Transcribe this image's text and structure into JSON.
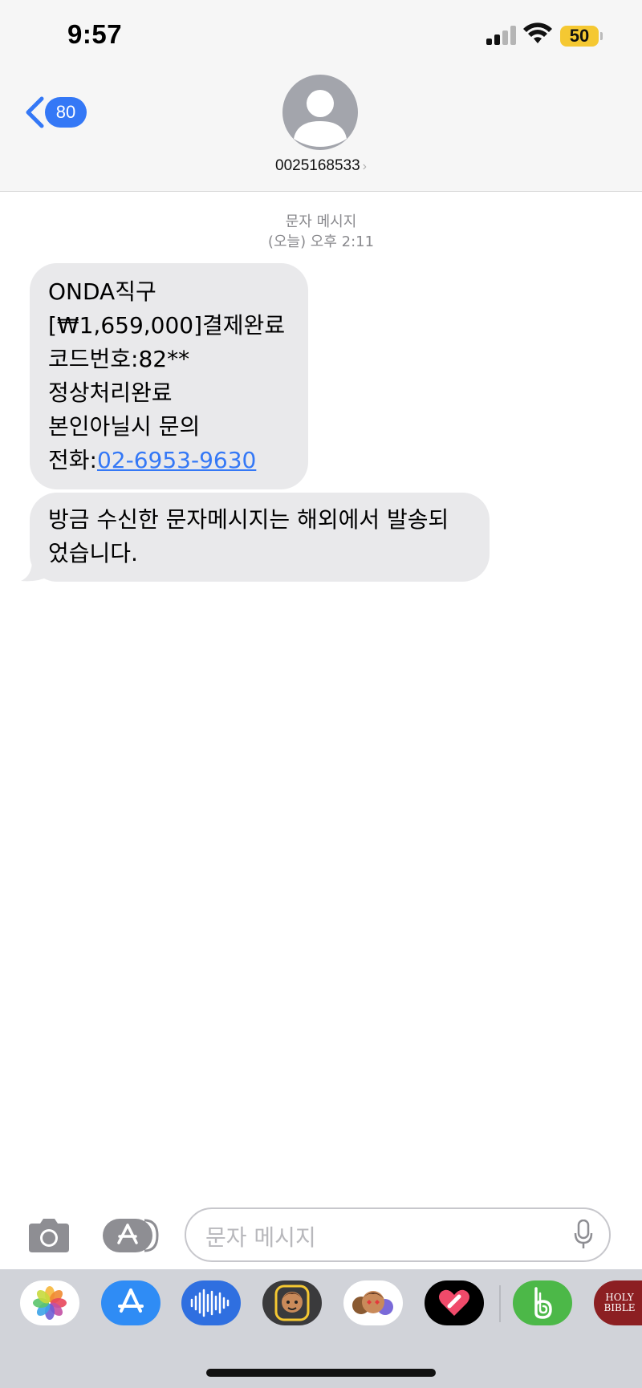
{
  "status_bar": {
    "time": "9:57",
    "battery": "50"
  },
  "header": {
    "back_count": "80",
    "contact": "0025168533",
    "contact_chevron": "›"
  },
  "conversation": {
    "service": "문자 메시지",
    "timestamp": "(오늘) 오후 2:11",
    "messages": [
      {
        "lines": [
          "ONDA직구",
          "[₩1,659,000]결제완료",
          "코드번호:82**",
          "정상처리완료",
          "본인아닐시 문의"
        ],
        "phone_prefix": "전화:",
        "phone_link": "02-6953-9630"
      },
      {
        "lines": [
          "방금 수신한 문자메시지는 해외에서 발송되",
          "었습니다."
        ]
      }
    ]
  },
  "compose": {
    "placeholder": "문자 메시지"
  },
  "app_drawer": {
    "apps": [
      "photos-icon",
      "app-store-icon",
      "audio-messages-icon",
      "memoji-icon",
      "memoji-stickers-icon",
      "digital-touch-icon",
      "b-app-icon",
      "holy-bible-icon"
    ],
    "bible_label": [
      "HOLY",
      "BIBLE"
    ]
  },
  "colors": {
    "accent": "#3478f6",
    "bubble": "#e9e9eb",
    "battery": "#f5c832"
  }
}
